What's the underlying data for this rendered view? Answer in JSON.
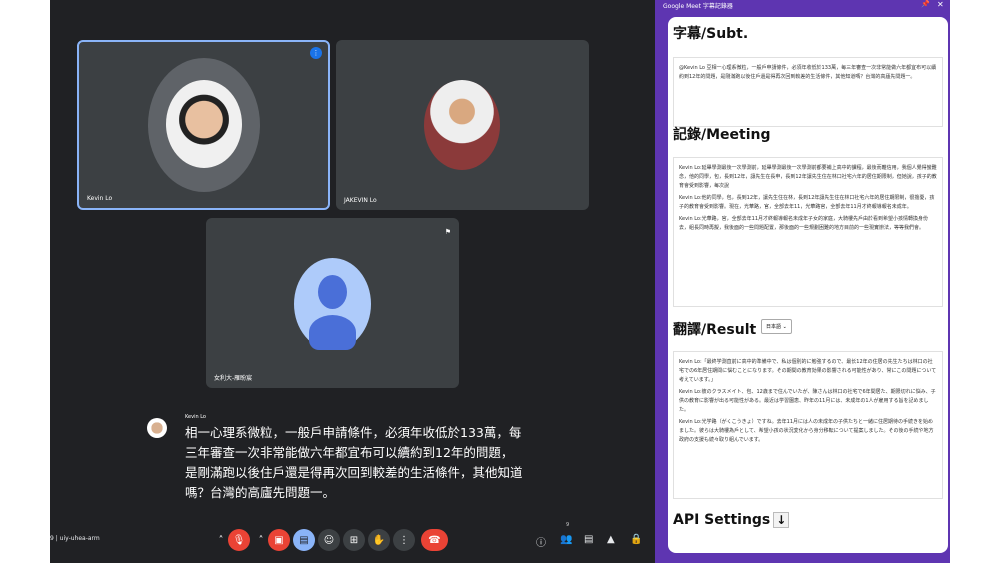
{
  "meet": {
    "participants": [
      {
        "name": "Kevin Lo",
        "speaking": true
      },
      {
        "name": "JAKEVIN Lo"
      },
      {
        "name": "女利大-雁盼宸"
      }
    ],
    "caption": {
      "speaker": "Kevin Lo",
      "text": "相一心理系微粒，一般戶申請條件，必須年收低於133萬，每三年審查一次非常能做六年都宜布可以續約到12年的問題，是剛滿跑以後住戶還是得再次回到較差的生活條件，其他知道嗎？台灣的高廬先問題一。"
    },
    "meeting_code": "9 | uiy-uhea-arm",
    "participant_count": "9",
    "accent_color": "#8ab4f8",
    "end_call_color": "#ea4335"
  },
  "panel": {
    "title": "Google Meet 字幕記錄器",
    "pin_icon": "pin-icon",
    "close_icon": "close-icon",
    "subt_heading": "字幕/Subt.",
    "subt_text": "@Kevin Lo 豆相一心理系微粒，一般戶申請條件，必須年收低於133萬，每三年審查一次非常能做六年都宜布可以續約到12年的問題，是剛滿跑以後住戶還是得再次回到較差的生活條件，其他知道嗎？台灣的高廬先問題一。",
    "meeting_heading": "記錄/Meeting",
    "meeting_items": [
      "Kevin Lo:延畢學測最後一次學測前，延畢學測最後一次學測前都要補上高中的課程，最後而離信用，我個人覺得蠻難念，他的同學，包，長到12年，讓先生在長申，長到12年讓先生住在林口社宅六年的居住期限制，但她說，孩子的教育會受到影響，每次說",
      "Kevin Lo:他的同學，包，長到12年，讓先生住在林，長到12年讓先生住在林口社宅六年的居住期限制，很擔憂，孩子的教育會受到影響。現在，光華路，官，全部去年11，光華路官，全部去年11月才終報導報名未成年。",
      "Kevin Lo:光華路，官，全部去年11月才終報導報名未成年子女的家庭，大騎樓先戶由於看到希望小孩情轉換身份去，組長同時再擬，我後面的一些問題配置，那後面的一些規劃困難的地方目前的一些現實辦法，等等我們會。"
    ],
    "result_heading": "翻譯/Result",
    "language": "日本語 ⌄",
    "result_items": [
      "Kevin Lo:「最終学測直前に高中的準備中で、私は個別的に勉強するので、最长12年の住居の先生たちは林口の社宅での6年居住期間に悩むことになります。その期間の教育効果の影響される可能性があり、常にこの問題について考えています。」",
      "Kevin Lo:彼のクラスメイト、包、12歳まで住んでいたが、陳さんは林口の社宅で6年間居た、期限切れに悩み、子供の教育に影響が出る可能性がある。最近は学習園恵、昨年の11月には、未成年の1人が雇用する旨を記めました。",
      "Kevin Lo:光学路（がくこうきょ）ですね。去年11月には人の未成年の子供たちと一緒に住居期待の手続きを始めました。彼らは大騎樓為戶として、希望小孩の状況変化から身分移転について提案しました。その後の手続や地方政府の支援も続々取り組んでいます。"
    ],
    "api_heading": "API Settings",
    "api_toggle": "↓",
    "panel_color": "#5e35b1"
  }
}
